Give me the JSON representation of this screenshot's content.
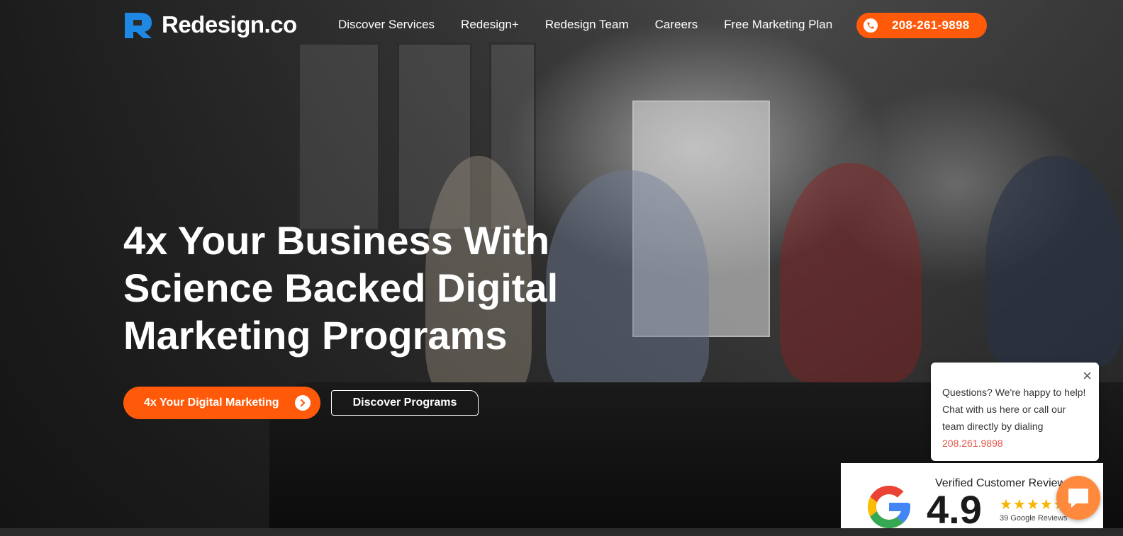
{
  "brand": {
    "name": "Redesign.co",
    "accent": "#ff5a0a",
    "logo_blue": "#1e88e5"
  },
  "nav": {
    "links": [
      "Discover Services",
      "Redesign+",
      "Redesign Team",
      "Careers",
      "Free Marketing Plan"
    ],
    "phone": "208-261-9898",
    "phone_icon": "phone-icon"
  },
  "hero": {
    "headline_lines": [
      "4x Your Business With",
      "Science Backed Digital",
      "Marketing Programs"
    ],
    "cta_primary": "4x Your Digital Marketing",
    "cta_secondary": "Discover Programs"
  },
  "chat_popup": {
    "lines": [
      "Questions? We're happy to help!",
      "Chat with us here or call our",
      "team directly by dialing"
    ],
    "phone": "208.261.9898",
    "close_icon": "close-icon",
    "phone_color": "#e2574c"
  },
  "review_badge": {
    "title": "Verified Customer Reviews",
    "score": "4.9",
    "stars": 5,
    "count_text": "39 Google Reviews",
    "star_color": "#f7b500"
  },
  "chat_launcher": {
    "icon": "chat-bubble-icon",
    "color": "#ff8a3d"
  }
}
